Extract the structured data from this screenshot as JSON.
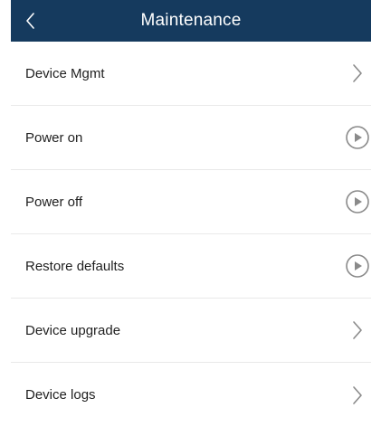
{
  "header": {
    "title": "Maintenance",
    "back_icon": "chevron-left-icon",
    "background": "#153a5e"
  },
  "items": [
    {
      "label": "Device Mgmt",
      "icon": "chevron-right-icon"
    },
    {
      "label": "Power on",
      "icon": "play-circle-icon"
    },
    {
      "label": "Power off",
      "icon": "play-circle-icon"
    },
    {
      "label": "Restore defaults",
      "icon": "play-circle-icon"
    },
    {
      "label": "Device upgrade",
      "icon": "chevron-right-icon"
    },
    {
      "label": "Device logs",
      "icon": "chevron-right-icon"
    }
  ]
}
